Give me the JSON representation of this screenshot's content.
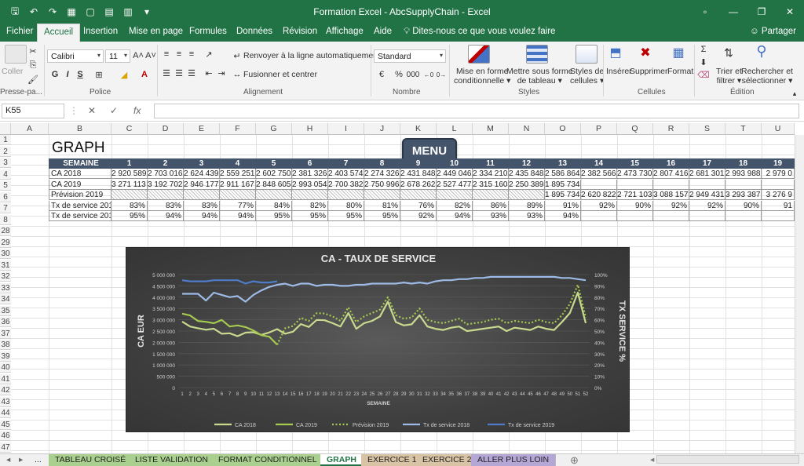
{
  "app": {
    "title": "Formation Excel - AbcSupplyChain  -  Excel",
    "colors": {
      "excel_green": "#217346",
      "header_blue": "#44546a",
      "chart_bg": "#404040"
    }
  },
  "quick_access": [
    "save-icon",
    "undo-icon",
    "redo-icon",
    "qat-icon"
  ],
  "menu_tabs": [
    "Fichier",
    "Accueil",
    "Insertion",
    "Mise en page",
    "Formules",
    "Données",
    "Révision",
    "Affichage",
    "Aide"
  ],
  "active_tab": "Accueil",
  "tell_me": "Dites-nous ce que vous voulez faire",
  "share": "Partager",
  "ribbon": {
    "paste": "Coller",
    "clipboard_group": "Presse-pa...",
    "font_name": "Calibri",
    "font_size": "11",
    "bold": "G",
    "italic": "I",
    "underline": "S",
    "font_group": "Police",
    "wrap_text": "Renvoyer à la ligne automatiquement",
    "merge": "Fusionner et centrer",
    "alignment_group": "Alignement",
    "number_format": "Standard",
    "percent": "%",
    "thousands": "000",
    "number_group": "Nombre",
    "conditional_format_1": "Mise en forme",
    "conditional_format_2": "conditionnelle",
    "format_table_1": "Mettre sous forme",
    "format_table_2": "de tableau",
    "cell_styles_1": "Styles de",
    "cell_styles_2": "cellules",
    "styles_group": "Styles",
    "insert": "Insérer",
    "delete": "Supprimer",
    "format": "Format",
    "cells_group": "Cellules",
    "sort_1": "Trier et",
    "sort_2": "filtrer",
    "find_1": "Rechercher et",
    "find_2": "sélectionner",
    "editing_group": "Édition"
  },
  "formula_bar": {
    "cell_ref": "K55",
    "fx": "fx",
    "value": ""
  },
  "columns": [
    "A",
    "B",
    "C",
    "D",
    "E",
    "F",
    "G",
    "H",
    "I",
    "J",
    "K",
    "L",
    "M",
    "N",
    "O",
    "P",
    "Q",
    "R",
    "S",
    "T",
    "U"
  ],
  "rows": [
    "1",
    "2",
    "3",
    "4",
    "5",
    "6",
    "7",
    "8",
    "28",
    "29",
    "30",
    "31",
    "32",
    "33",
    "34",
    "35",
    "36",
    "37",
    "38",
    "39",
    "40",
    "41",
    "42",
    "43",
    "44",
    "45",
    "46",
    "47"
  ],
  "sheet": {
    "title": "GRAPH",
    "menu_button": "MENU",
    "table": {
      "header_label": "SEMAINE",
      "weeks": [
        "1",
        "2",
        "3",
        "4",
        "5",
        "6",
        "7",
        "8",
        "9",
        "10",
        "11",
        "12",
        "13",
        "14",
        "15",
        "16",
        "17",
        "18",
        "19"
      ],
      "rows": [
        {
          "label": "CA 2018",
          "values": [
            "2 920 589",
            "2 703 016",
            "2 624 439",
            "2 559 251",
            "2 602 750",
            "2 381 326",
            "2 403 574",
            "2 274 326",
            "2 431 848",
            "2 449 046",
            "2 334 210",
            "2 435 848",
            "2 586 864",
            "2 382 566",
            "2 473 730",
            "2 807 416",
            "2 681 301",
            "2 993 988",
            "2 979 0"
          ]
        },
        {
          "label": "CA 2019",
          "values": [
            "3 271 113",
            "3 192 702",
            "2 946 177",
            "2 911 167",
            "2 848 605",
            "2 993 054",
            "2 700 382",
            "2 750 996",
            "2 678 262",
            "2 527 477",
            "2 315 160",
            "2 250 389",
            "1 895 734",
            "",
            "",
            "",
            "",
            "",
            ""
          ]
        },
        {
          "label": "Prévision 2019",
          "values": [
            "",
            "",
            "",
            "",
            "",
            "",
            "",
            "",
            "",
            "",
            "",
            "",
            "1 895 734",
            "2 620 822",
            "2 721 103",
            "3 088 157",
            "2 949 431",
            "3 293 387",
            "3 276 9"
          ]
        },
        {
          "label": "Tx de service 2018",
          "values": [
            "83%",
            "83%",
            "83%",
            "77%",
            "84%",
            "82%",
            "80%",
            "81%",
            "76%",
            "82%",
            "86%",
            "89%",
            "91%",
            "92%",
            "90%",
            "92%",
            "92%",
            "90%",
            "91"
          ]
        },
        {
          "label": "Tx de service 2019",
          "values": [
            "95%",
            "94%",
            "94%",
            "94%",
            "95%",
            "95%",
            "95%",
            "95%",
            "92%",
            "94%",
            "93%",
            "93%",
            "94%",
            "",
            "",
            "",
            "",
            "",
            ""
          ]
        }
      ]
    }
  },
  "chart_data": {
    "type": "line",
    "title": "CA - TAUX DE SERVICE",
    "xlabel": "SEMAINE",
    "ylabel": "CA  EUR",
    "y2label": "TX SERVICE %",
    "x": [
      1,
      2,
      3,
      4,
      5,
      6,
      7,
      8,
      9,
      10,
      11,
      12,
      13,
      14,
      15,
      16,
      17,
      18,
      19,
      20,
      21,
      22,
      23,
      24,
      25,
      26,
      27,
      28,
      29,
      30,
      31,
      32,
      33,
      34,
      35,
      36,
      37,
      38,
      39,
      40,
      41,
      42,
      43,
      44,
      45,
      46,
      47,
      48,
      49,
      50,
      51,
      52
    ],
    "ylim": [
      0,
      5000000
    ],
    "y_ticks": [
      "0",
      "500 000",
      "1 000 000",
      "1 500 000",
      "2 000 000",
      "2 500 000",
      "3 000 000",
      "3 500 000",
      "4 000 000",
      "4 500 000",
      "5 000 000"
    ],
    "y2lim": [
      0,
      100
    ],
    "y2_ticks": [
      "0%",
      "10%",
      "20%",
      "30%",
      "40%",
      "50%",
      "60%",
      "70%",
      "80%",
      "90%",
      "100%"
    ],
    "legend_position": "bottom",
    "grid": true,
    "series": [
      {
        "name": "CA 2018",
        "axis": "left",
        "color": "#c9da8f",
        "style": "solid",
        "values": [
          2920589,
          2703016,
          2624439,
          2559251,
          2602750,
          2381326,
          2403574,
          2274326,
          2431848,
          2449046,
          2334210,
          2435848,
          2586864,
          2382566,
          2473730,
          2807416,
          2681301,
          2993988,
          2979000,
          2850000,
          2700000,
          3300000,
          2600000,
          2850000,
          2950000,
          3150000,
          3800000,
          2900000,
          2750000,
          2800000,
          3200000,
          2700000,
          2600000,
          2550000,
          2650000,
          2700000,
          2500000,
          2550000,
          2600000,
          2650000,
          2700000,
          2500000,
          2650000,
          2600000,
          2550000,
          2700000,
          2600000,
          2550000,
          2900000,
          3300000,
          4200000,
          2850000
        ]
      },
      {
        "name": "CA 2019",
        "axis": "left",
        "color": "#a6c94f",
        "style": "solid",
        "values": [
          3271113,
          3192702,
          2946177,
          2911167,
          2848605,
          2993054,
          2700382,
          2750996,
          2678262,
          2527477,
          2315160,
          2250389,
          1895734,
          null,
          null,
          null,
          null,
          null,
          null,
          null,
          null,
          null,
          null,
          null,
          null,
          null,
          null,
          null,
          null,
          null,
          null,
          null,
          null,
          null,
          null,
          null,
          null,
          null,
          null,
          null,
          null,
          null,
          null,
          null,
          null,
          null,
          null,
          null,
          null,
          null,
          null,
          null
        ]
      },
      {
        "name": "Prévision 2019",
        "axis": "left",
        "color": "#a6c94f",
        "style": "dotted",
        "values": [
          null,
          null,
          null,
          null,
          null,
          null,
          null,
          null,
          null,
          null,
          null,
          null,
          1895734,
          2620822,
          2721103,
          3088157,
          2949431,
          3293387,
          3276900,
          3150000,
          2950000,
          3550000,
          2900000,
          3150000,
          3300000,
          3450000,
          4000000,
          3200000,
          3050000,
          3100000,
          3500000,
          3000000,
          2900000,
          2850000,
          2950000,
          3050000,
          2800000,
          2850000,
          2900000,
          3000000,
          3050000,
          2850000,
          2950000,
          2900000,
          2850000,
          3000000,
          2900000,
          2850000,
          3200000,
          3700000,
          4550000,
          3100000
        ]
      },
      {
        "name": "Tx de service 2018",
        "axis": "right",
        "color": "#9dbbe6",
        "style": "solid",
        "values": [
          83,
          83,
          83,
          77,
          84,
          82,
          80,
          81,
          76,
          82,
          86,
          89,
          91,
          92,
          90,
          92,
          92,
          90,
          91,
          91,
          90,
          90,
          91,
          91,
          92,
          92,
          92,
          92,
          93,
          92,
          93,
          92,
          94,
          95,
          95,
          96,
          96,
          97,
          97,
          98,
          98,
          98,
          98,
          98,
          98,
          98,
          98,
          98,
          97,
          97,
          96,
          95
        ]
      },
      {
        "name": "Tx de service 2019",
        "axis": "right",
        "color": "#4f7cc8",
        "style": "solid",
        "values": [
          95,
          94,
          94,
          94,
          95,
          95,
          95,
          95,
          92,
          94,
          93,
          93,
          94,
          null,
          null,
          null,
          null,
          null,
          null,
          null,
          null,
          null,
          null,
          null,
          null,
          null,
          null,
          null,
          null,
          null,
          null,
          null,
          null,
          null,
          null,
          null,
          null,
          null,
          null,
          null,
          null,
          null,
          null,
          null,
          null,
          null,
          null,
          null,
          null,
          null,
          null,
          null
        ]
      }
    ]
  },
  "sheet_tabs": [
    {
      "label": "TABLEAU CROISÉ",
      "color": "#a9d08e"
    },
    {
      "label": "LISTE VALIDATION",
      "color": "#a9d08e"
    },
    {
      "label": "FORMAT CONDITIONNEL",
      "color": "#a9d08e"
    },
    {
      "label": "GRAPH",
      "color": "#ffffff"
    },
    {
      "label": "EXERCICE 1",
      "color": "#d9c3a5"
    },
    {
      "label": "EXERCICE 2",
      "color": "#d9c3a5"
    },
    {
      "label": "ALLER PLUS LOIN",
      "color": "#b4a7d6"
    }
  ],
  "sheet_nav_more": "..."
}
